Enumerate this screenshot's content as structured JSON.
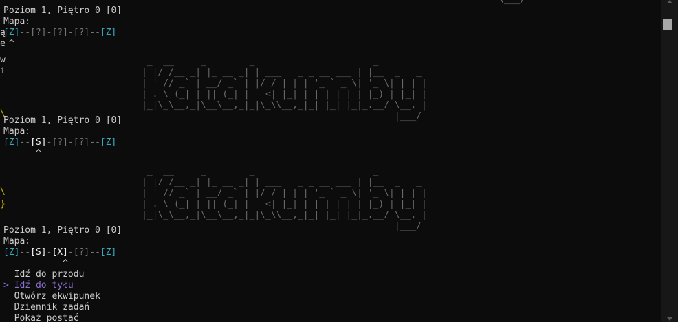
{
  "screens": [
    {
      "header": "Poziom 1, Piętro 0 [0]",
      "map_label": "Mapa:",
      "map": [
        "[Z]",
        "--",
        "[?]",
        "-",
        "[?]",
        "-",
        "[?]",
        "--",
        "[Z]"
      ],
      "marker": " ^"
    },
    {
      "header": "Poziom 1, Piętro 0 [0]",
      "map_label": "Mapa:",
      "map": [
        "[Z]",
        "--",
        "[S]",
        "-",
        "[?]",
        "-",
        "[?]",
        "--",
        "[Z]"
      ],
      "marker": "      ^"
    },
    {
      "header": "Poziom 1, Piętro 0 [0]",
      "map_label": "Mapa:",
      "map": [
        "[Z]",
        "--",
        "[S]",
        "-",
        "[X]",
        "-",
        "[?]",
        "--",
        "[Z]"
      ],
      "marker": "           ^"
    }
  ],
  "top_fragment": "                                                                                            \\___/",
  "banner": {
    "text": "Katakumby",
    "ascii": " _  __     _        _                      _          \n| |/ /__ _| |_ __ _| | ___   _ _ __ ___ | |__  _   _ \n| ' // _` | __/ _` | |/ / | | | '_ ` _ \\| '_ \\| | | |\n| . \\ (_| | || (_| |   <| |_| | | | | | | |_) | |_| |\n|_|\\_\\__,_|\\__\\__,_|_|\\_\\\\__,_|_| |_| |_|_.__/ \\__, |\n                                               |___/ "
  },
  "menu": {
    "pointer": ">",
    "items": [
      "Idź do przodu",
      "Idź do tyłu",
      "Otwórz ekwipunek",
      "Dziennik zadań",
      "Pokaż postać"
    ],
    "selected_index": 1
  },
  "colors": {
    "background": "#0c0c0c",
    "text": "#cccccc",
    "map_edge": "#3aa6b9",
    "map_unknown": "#767676",
    "selected": "#8b6fd0",
    "ascii": "#6a6a6a"
  }
}
